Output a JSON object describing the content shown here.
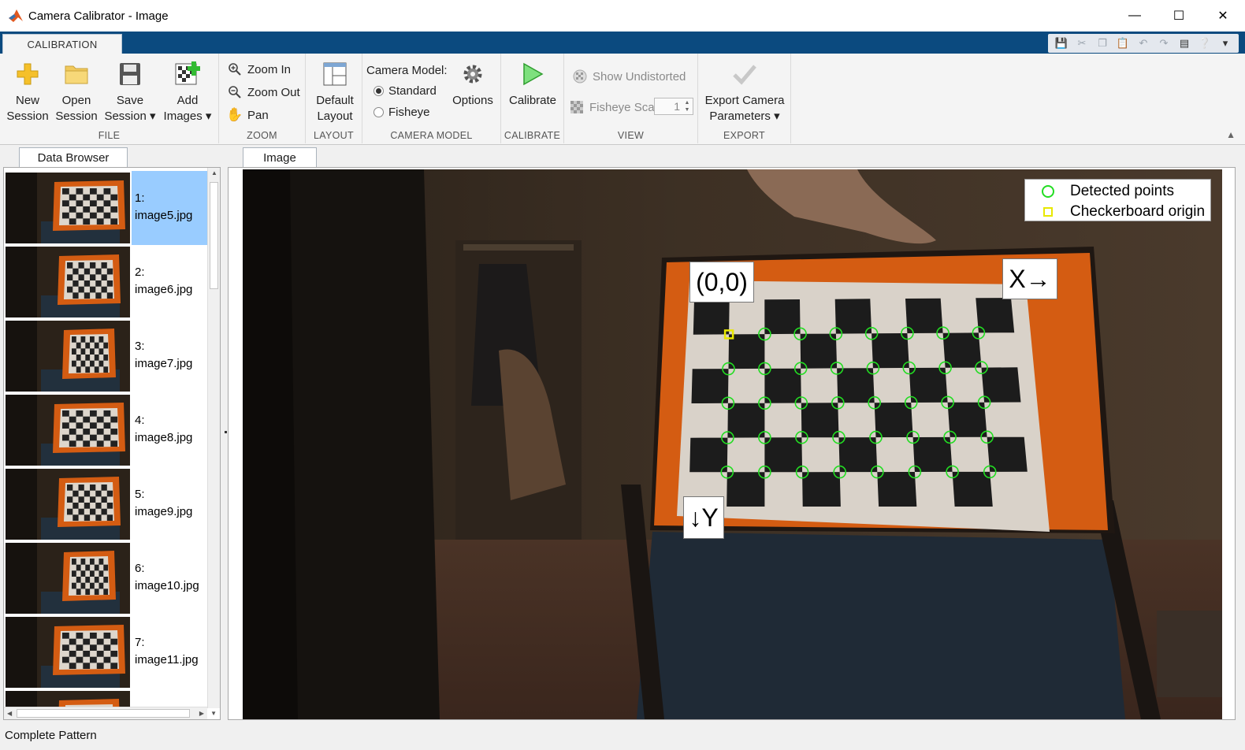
{
  "window": {
    "title": "Camera Calibrator - Image"
  },
  "ribbon_tab": "CALIBRATION",
  "file": {
    "new_session": [
      "New",
      "Session"
    ],
    "open_session": [
      "Open",
      "Session"
    ],
    "save_session": [
      "Save",
      "Session"
    ],
    "add_images": [
      "Add",
      "Images"
    ],
    "label": "FILE"
  },
  "zoom": {
    "zoom_in": "Zoom In",
    "zoom_out": "Zoom Out",
    "pan": "Pan",
    "label": "ZOOM"
  },
  "layout": {
    "default_layout": [
      "Default",
      "Layout"
    ],
    "label": "LAYOUT"
  },
  "camera_model": {
    "title": "Camera Model:",
    "standard": "Standard",
    "fisheye": "Fisheye",
    "selected": "Standard",
    "options": "Options",
    "label": "CAMERA MODEL"
  },
  "calibrate": {
    "button": "Calibrate",
    "label": "CALIBRATE"
  },
  "view": {
    "show_undistorted": "Show Undistorted",
    "fisheye_scale": "Fisheye Scale",
    "fisheye_scale_value": "1",
    "label": "VIEW"
  },
  "export": {
    "button": [
      "Export Camera",
      "Parameters"
    ],
    "label": "EXPORT"
  },
  "data_browser": {
    "tab": "Data Browser",
    "items": [
      {
        "index": "1:",
        "name": "image5.jpg"
      },
      {
        "index": "2:",
        "name": "image6.jpg"
      },
      {
        "index": "3:",
        "name": "image7.jpg"
      },
      {
        "index": "4:",
        "name": "image8.jpg"
      },
      {
        "index": "5:",
        "name": "image9.jpg"
      },
      {
        "index": "6:",
        "name": "image10.jpg"
      },
      {
        "index": "7:",
        "name": "image11.jpg"
      }
    ],
    "selected_index": 0
  },
  "image_panel": {
    "tab": "Image",
    "legend": {
      "detected": "Detected points",
      "origin": "Checkerboard origin"
    },
    "origin_label": "(0,0)",
    "x_label": "X→",
    "y_label": "↓Y"
  },
  "status": "Complete Pattern",
  "colors": {
    "ribbon_strip": "#0b4a7f",
    "selection": "#99ccff",
    "detected": "#22dd22",
    "origin": "#e8e800"
  }
}
